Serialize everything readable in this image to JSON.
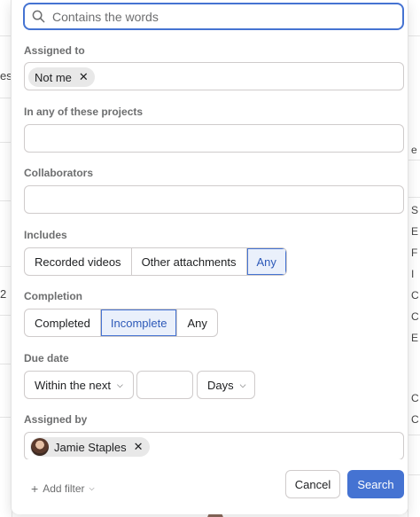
{
  "background": {
    "left_fragments": [
      "es",
      "2"
    ],
    "right_fragments": [
      "e",
      "S",
      "E",
      "F",
      "I",
      "C",
      "C",
      "E",
      "C",
      "C"
    ]
  },
  "search": {
    "placeholder": "Contains the words",
    "value": ""
  },
  "assigned_to": {
    "label": "Assigned to",
    "chips": [
      "Not me"
    ]
  },
  "projects": {
    "label": "In any of these projects",
    "value": ""
  },
  "collaborators": {
    "label": "Collaborators",
    "value": ""
  },
  "includes": {
    "label": "Includes",
    "options": [
      "Recorded videos",
      "Other attachments",
      "Any"
    ],
    "selected": "Any"
  },
  "completion": {
    "label": "Completion",
    "options": [
      "Completed",
      "Incomplete",
      "Any"
    ],
    "selected": "Incomplete"
  },
  "due_date": {
    "label": "Due date",
    "range": "Within the next",
    "amount": "",
    "unit": "Days"
  },
  "assigned_by": {
    "label": "Assigned by",
    "chips": [
      "Jamie Staples"
    ]
  },
  "footer": {
    "add_filter": "Add filter",
    "cancel": "Cancel",
    "search": "Search"
  },
  "colors": {
    "accent": "#4573d2",
    "selected_bg": "#eaf0fb"
  }
}
